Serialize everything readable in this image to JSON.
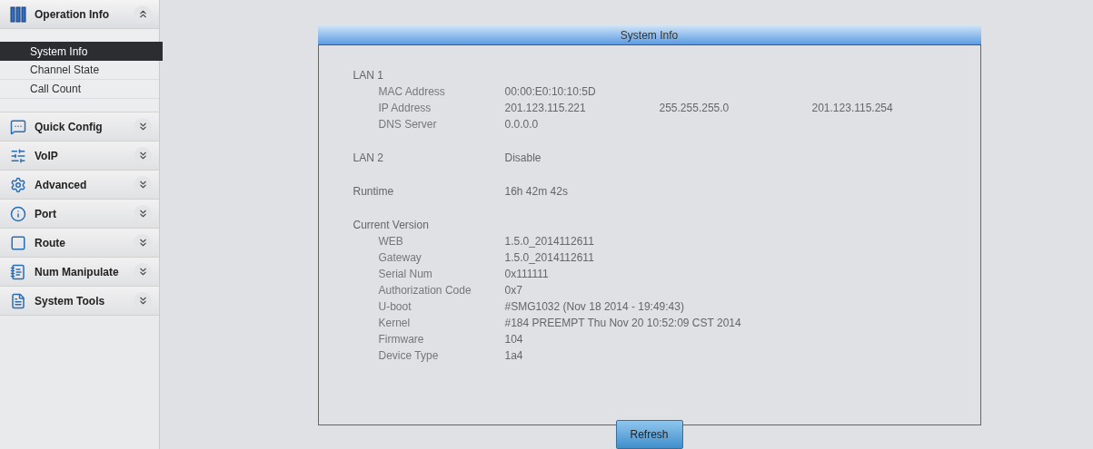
{
  "sidebar": {
    "groups": [
      {
        "label": "Operation Info",
        "expanded": true,
        "items": [
          {
            "label": "System Info",
            "selected": true
          },
          {
            "label": "Channel State",
            "selected": false
          },
          {
            "label": "Call Count",
            "selected": false
          }
        ]
      },
      {
        "label": "Quick Config",
        "expanded": false
      },
      {
        "label": "VoIP",
        "expanded": false
      },
      {
        "label": "Advanced",
        "expanded": false
      },
      {
        "label": "Port",
        "expanded": false
      },
      {
        "label": "Route",
        "expanded": false
      },
      {
        "label": "Num Manipulate",
        "expanded": false
      },
      {
        "label": "System Tools",
        "expanded": false
      }
    ]
  },
  "panel": {
    "title": "System Info",
    "sections": [
      {
        "title": "LAN 1",
        "rows": [
          {
            "label": "MAC Address",
            "values": [
              "00:00:E0:10:10:5D"
            ]
          },
          {
            "label": "IP Address",
            "values": [
              "201.123.115.221",
              "255.255.255.0",
              "201.123.115.254"
            ]
          },
          {
            "label": "DNS Server",
            "values": [
              "0.0.0.0"
            ]
          }
        ]
      },
      {
        "title": "LAN 2",
        "value": "Disable"
      },
      {
        "title": "Runtime",
        "value": "16h 42m 42s"
      },
      {
        "title": "Current Version",
        "rows": [
          {
            "label": "WEB",
            "values": [
              "1.5.0_2014112611"
            ]
          },
          {
            "label": "Gateway",
            "values": [
              "1.5.0_2014112611"
            ]
          },
          {
            "label": "Serial Num",
            "values": [
              "0x111111"
            ]
          },
          {
            "label": "Authorization Code",
            "values": [
              "0x7"
            ]
          },
          {
            "label": "U-boot",
            "values": [
              "#SMG1032 (Nov 18 2014 - 19:49:43)"
            ]
          },
          {
            "label": "Kernel",
            "values": [
              "#184 PREEMPT Thu Nov 20 10:52:09 CST 2014"
            ]
          },
          {
            "label": "Firmware",
            "values": [
              "104"
            ]
          },
          {
            "label": "Device Type",
            "values": [
              "1a4"
            ]
          }
        ]
      }
    ]
  },
  "refresh_button": "Refresh"
}
